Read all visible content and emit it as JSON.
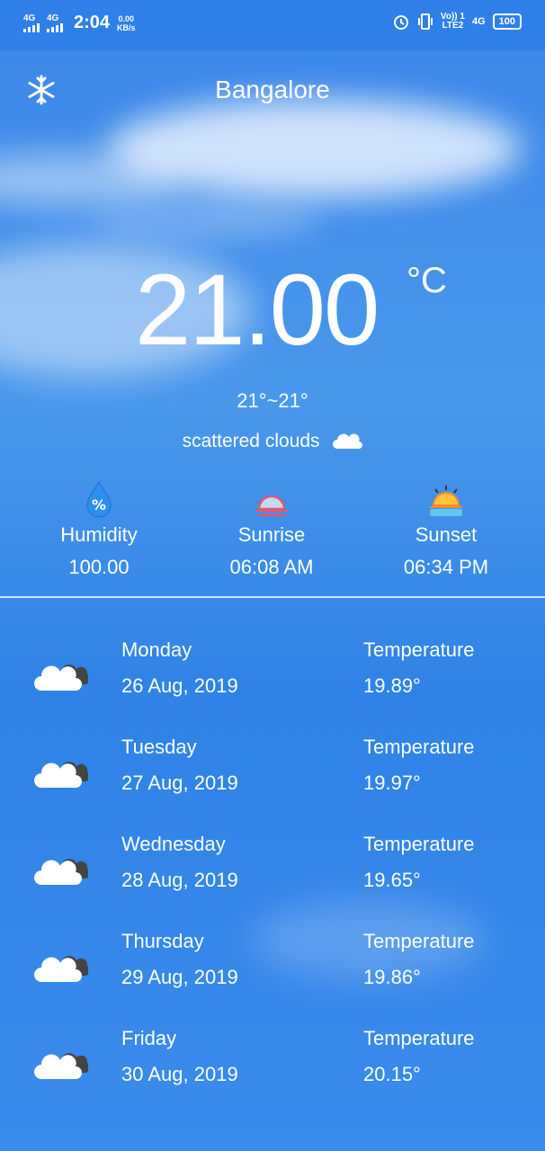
{
  "status_bar": {
    "signal1": "4G",
    "signal2": "4G",
    "time": "2:04",
    "speed_value": "0.00",
    "speed_unit": "KB/s",
    "volte": "Vo)) 1",
    "lte": "LTE2",
    "network": "4G",
    "battery": "100"
  },
  "header": {
    "city": "Bangalore"
  },
  "current": {
    "temperature": "21.00",
    "unit": "°C",
    "range": "21°~21°",
    "description": "scattered clouds"
  },
  "stats": [
    {
      "label": "Humidity",
      "value": "100.00",
      "icon": "humidity-icon"
    },
    {
      "label": "Sunrise",
      "value": "06:08 AM",
      "icon": "sunrise-icon"
    },
    {
      "label": "Sunset",
      "value": "06:34 PM",
      "icon": "sunset-icon"
    }
  ],
  "forecast": [
    {
      "day": "Monday",
      "date": "26 Aug, 2019",
      "temp_label": "Temperature",
      "temp": "19.89°"
    },
    {
      "day": "Tuesday",
      "date": "27 Aug, 2019",
      "temp_label": "Temperature",
      "temp": "19.97°"
    },
    {
      "day": "Wednesday",
      "date": "28 Aug, 2019",
      "temp_label": "Temperature",
      "temp": "19.65°"
    },
    {
      "day": "Thursday",
      "date": "29 Aug, 2019",
      "temp_label": "Temperature",
      "temp": "19.86°"
    },
    {
      "day": "Friday",
      "date": "30 Aug, 2019",
      "temp_label": "Temperature",
      "temp": "20.15°"
    }
  ],
  "colors": {
    "accent": "#2f82e6",
    "status_bar": "#2f7fe8"
  }
}
